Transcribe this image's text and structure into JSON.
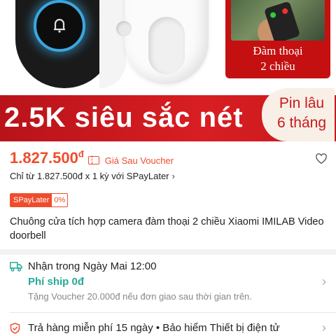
{
  "hero": {
    "call_card_line1": "Đàm thoại",
    "call_card_line2": "2 chiều",
    "banner_main": "2.5K siêu sắc nét",
    "badge_line1": "Pin lâu",
    "badge_line2": "6 tháng"
  },
  "price": {
    "amount": "1.827.500",
    "currency": "đ",
    "note": "Giá Sau Voucher"
  },
  "spaylater": {
    "line": "Chỉ từ 1.827.500đ x 1 kỳ với SPayLater",
    "badge_label": "SPayLater",
    "badge_rate": "0%"
  },
  "product": {
    "title": "Chuông cửa tích hợp camera đàm thoại 2 chiều Xiaomi IMILAB Video doorbell"
  },
  "shipping": {
    "delivery": "Nhận trong Ngày Mai 12:00",
    "fee": "Phí ship 0đ",
    "voucher_note": "Tặng Voucher 20.000đ nếu đơn giao sau thời gian trên."
  },
  "returns": {
    "text": "Trả hàng miễn phí 15 ngày  •  Bảo hiểm Thiết bị điện tử"
  },
  "icons": {
    "heart": "heart-icon",
    "truck": "truck-icon",
    "shield": "shield-icon",
    "voucher": "voucher-icon",
    "chevron": "chevron-right-icon"
  },
  "colors": {
    "accent": "#ee4d2d",
    "shipping_green": "#26aa99",
    "banner_red": "#d81e22"
  }
}
